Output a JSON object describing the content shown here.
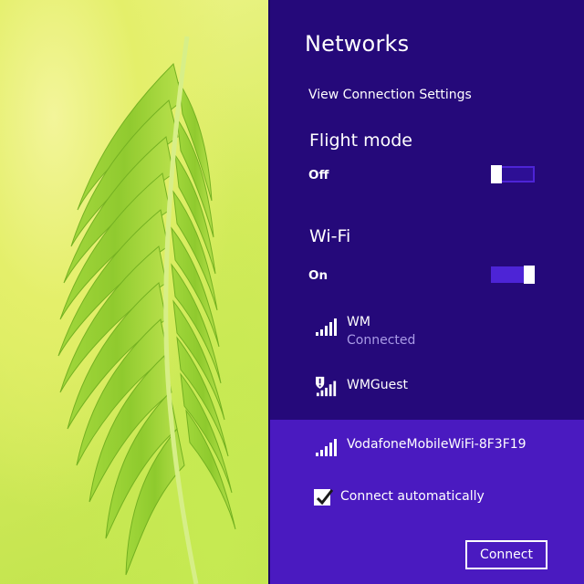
{
  "panel": {
    "title": "Networks",
    "view_settings_link": "View Connection Settings",
    "flight_mode": {
      "heading": "Flight mode",
      "state_label": "Off",
      "enabled": false
    },
    "wifi": {
      "heading": "Wi-Fi",
      "state_label": "On",
      "enabled": true
    },
    "networks": [
      {
        "name": "WM",
        "status": "Connected",
        "icon": "wifi-signal-icon"
      },
      {
        "name": "WMGuest",
        "status": "",
        "icon": "wifi-shield-warning-icon"
      },
      {
        "name": "VodafoneMobileWiFi-8F3F19",
        "status": "",
        "icon": "wifi-signal-icon",
        "selected": true
      }
    ],
    "selected_network": {
      "connect_automatically_label": "Connect automatically",
      "connect_automatically_checked": true,
      "connect_button_label": "Connect"
    }
  },
  "colors": {
    "panel_background": "#25097a",
    "selected_background": "#4a1ac0",
    "toggle_accent": "#4d24d6",
    "status_text": "#a99be6"
  }
}
